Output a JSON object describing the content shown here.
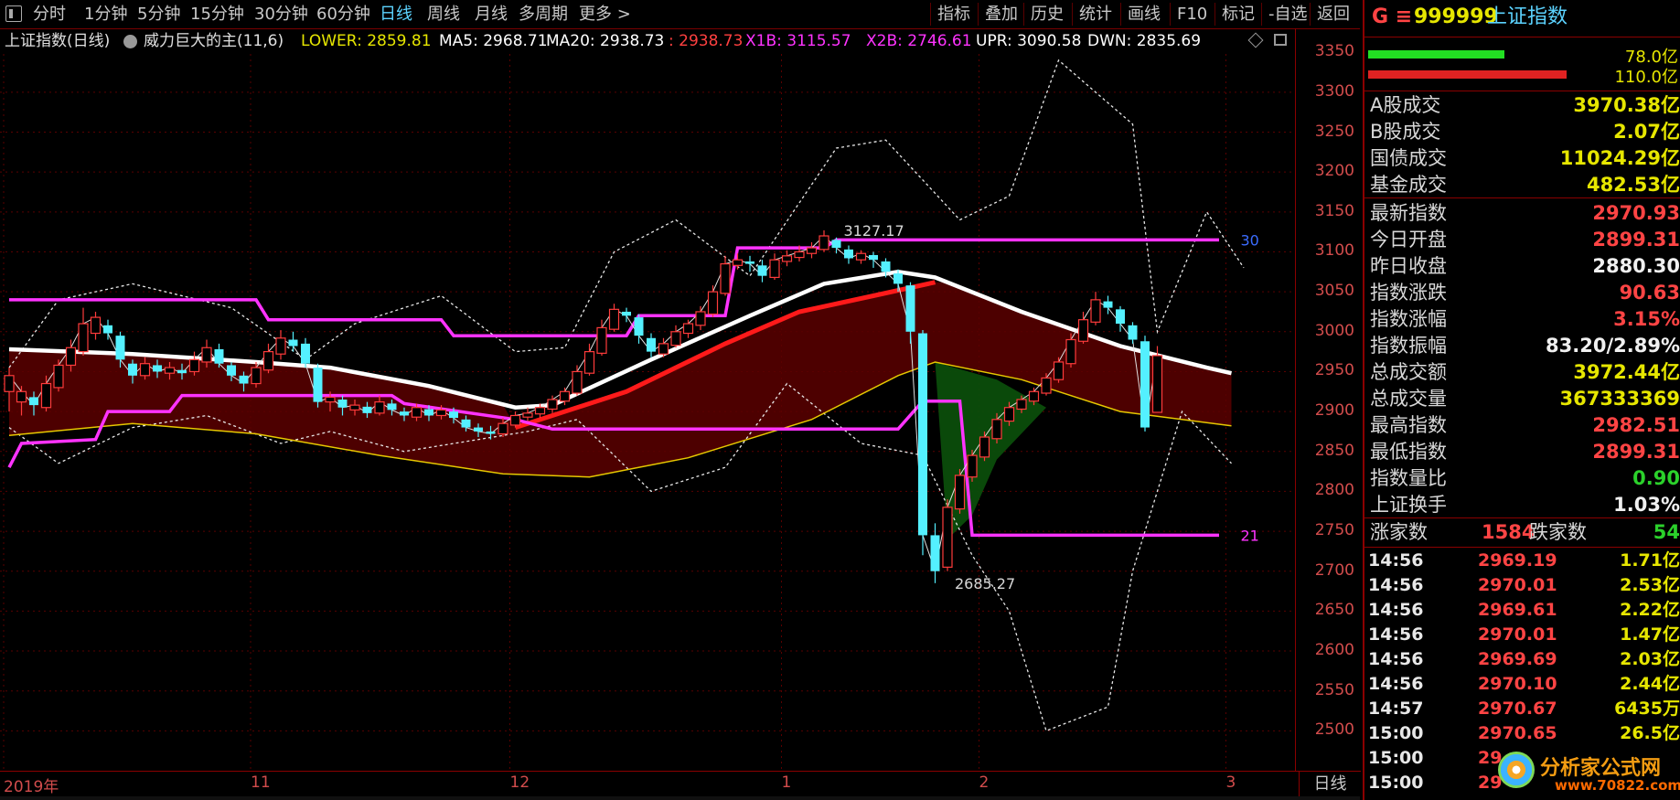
{
  "toolbar": {
    "left_items": [
      "分时",
      "1分钟",
      "5分钟",
      "15分钟",
      "30分钟",
      "60分钟",
      "日线",
      "周线",
      "月线",
      "多周期",
      "更多 >"
    ],
    "active_index": 6,
    "right_items": [
      "指标",
      "叠加",
      "历史",
      "统计",
      "画线",
      "F10",
      "标记",
      "-自选",
      "返回"
    ]
  },
  "info": {
    "title": "上证指数(日线)",
    "indicator": "威力巨大的主(11,6)",
    "lower": "LOWER: 2859.81",
    "ma5": "MA5: 2968.71",
    "ma20": "MA20: 2938.73",
    "blank": ": 2938.73",
    "x1b": "X1B: 3115.57",
    "x2b": "X2B: 2746.61",
    "upr": "UPR: 3090.58",
    "dwn": "DWN: 2835.69"
  },
  "colors": {
    "bg": "#000000",
    "grid": "#5a0000",
    "axis_text": "#d24c4c",
    "up_candle": "#ff3b3b",
    "down_candle": "#54f0ff",
    "magenta": "#ff33ff",
    "white_line": "#ffffff",
    "yellow_line": "#e6c800",
    "fill_dark_red": "#5a0000",
    "fill_green": "#0b4d0b"
  },
  "chart_data": {
    "type": "candlestick",
    "ylim": [
      2450,
      3380
    ],
    "yticks": [
      2500,
      2550,
      2600,
      2650,
      2700,
      2750,
      2800,
      2850,
      2900,
      2950,
      3000,
      3050,
      3100,
      3150,
      3200,
      3250,
      3300,
      3350
    ],
    "date_labels": [
      {
        "text": "2019年",
        "index": 0
      },
      {
        "text": "11",
        "index": 20
      },
      {
        "text": "12",
        "index": 41
      },
      {
        "text": "1",
        "index": 63
      },
      {
        "text": "2",
        "index": 79
      },
      {
        "text": "3",
        "index": 99
      }
    ],
    "candles": [
      [
        2925,
        2945,
        2900,
        2955
      ],
      [
        2912,
        2925,
        2895,
        2932
      ],
      [
        2918,
        2908,
        2895,
        2925
      ],
      [
        2905,
        2935,
        2900,
        2945
      ],
      [
        2930,
        2958,
        2925,
        2965
      ],
      [
        2958,
        2980,
        2950,
        2990
      ],
      [
        2975,
        3010,
        2970,
        3030
      ],
      [
        2998,
        3018,
        2990,
        3025
      ],
      [
        3008,
        2998,
        2990,
        3015
      ],
      [
        2995,
        2965,
        2955,
        3000
      ],
      [
        2960,
        2945,
        2935,
        2965
      ],
      [
        2945,
        2960,
        2940,
        2968
      ],
      [
        2958,
        2950,
        2942,
        2965
      ],
      [
        2948,
        2955,
        2940,
        2962
      ],
      [
        2952,
        2948,
        2940,
        2960
      ],
      [
        2950,
        2965,
        2945,
        2975
      ],
      [
        2962,
        2980,
        2955,
        2990
      ],
      [
        2978,
        2960,
        2955,
        2985
      ],
      [
        2958,
        2945,
        2938,
        2962
      ],
      [
        2945,
        2935,
        2925,
        2950
      ],
      [
        2935,
        2955,
        2930,
        2962
      ],
      [
        2952,
        2975,
        2948,
        2985
      ],
      [
        2972,
        2992,
        2965,
        3002
      ],
      [
        2990,
        2982,
        2975,
        3000
      ],
      [
        2985,
        2960,
        2955,
        2992
      ],
      [
        2955,
        2912,
        2905,
        2960
      ],
      [
        2912,
        2918,
        2900,
        2925
      ],
      [
        2915,
        2905,
        2895,
        2920
      ],
      [
        2902,
        2908,
        2895,
        2915
      ],
      [
        2906,
        2898,
        2892,
        2912
      ],
      [
        2898,
        2912,
        2895,
        2920
      ],
      [
        2910,
        2902,
        2895,
        2915
      ],
      [
        2900,
        2895,
        2888,
        2905
      ],
      [
        2893,
        2905,
        2888,
        2910
      ],
      [
        2903,
        2895,
        2888,
        2908
      ],
      [
        2895,
        2902,
        2890,
        2908
      ],
      [
        2900,
        2892,
        2885,
        2905
      ],
      [
        2890,
        2880,
        2875,
        2895
      ],
      [
        2880,
        2875,
        2868,
        2885
      ],
      [
        2875,
        2872,
        2865,
        2882
      ],
      [
        2872,
        2885,
        2868,
        2892
      ],
      [
        2883,
        2895,
        2880,
        2900
      ],
      [
        2893,
        2898,
        2888,
        2905
      ],
      [
        2897,
        2905,
        2892,
        2910
      ],
      [
        2903,
        2915,
        2898,
        2920
      ],
      [
        2913,
        2925,
        2908,
        2930
      ],
      [
        2923,
        2950,
        2920,
        2958
      ],
      [
        2948,
        2975,
        2945,
        2985
      ],
      [
        2973,
        3005,
        2970,
        3015
      ],
      [
        3003,
        3028,
        3000,
        3035
      ],
      [
        3025,
        3020,
        3012,
        3030
      ],
      [
        3018,
        2995,
        2985,
        3022
      ],
      [
        2992,
        2975,
        2968,
        2998
      ],
      [
        2972,
        2985,
        2968,
        2992
      ],
      [
        2983,
        3000,
        2980,
        3008
      ],
      [
        2998,
        3010,
        2992,
        3015
      ],
      [
        3008,
        3025,
        3002,
        3032
      ],
      [
        3022,
        3050,
        3018,
        3058
      ],
      [
        3048,
        3085,
        3045,
        3095
      ],
      [
        3083,
        3090,
        3078,
        3098
      ],
      [
        3088,
        3085,
        3075,
        3095
      ],
      [
        3083,
        3070,
        3062,
        3090
      ],
      [
        3068,
        3090,
        3065,
        3098
      ],
      [
        3088,
        3095,
        3082,
        3102
      ],
      [
        3093,
        3100,
        3088,
        3108
      ],
      [
        3098,
        3105,
        3092,
        3112
      ],
      [
        3103,
        3120,
        3100,
        3127
      ],
      [
        3115,
        3105,
        3098,
        3118
      ],
      [
        3103,
        3092,
        3085,
        3108
      ],
      [
        3090,
        3098,
        3085,
        3102
      ],
      [
        3096,
        3090,
        3080,
        3100
      ],
      [
        3088,
        3075,
        3068,
        3092
      ],
      [
        3073,
        3060,
        3050,
        3078
      ],
      [
        3058,
        3000,
        2985,
        3062
      ],
      [
        2998,
        2745,
        2720,
        3002
      ],
      [
        2745,
        2700,
        2685,
        2760
      ],
      [
        2705,
        2780,
        2700,
        2790
      ],
      [
        2778,
        2820,
        2772,
        2828
      ],
      [
        2818,
        2845,
        2812,
        2852
      ],
      [
        2843,
        2868,
        2838,
        2875
      ],
      [
        2866,
        2890,
        2860,
        2898
      ],
      [
        2888,
        2905,
        2882,
        2912
      ],
      [
        2903,
        2915,
        2898,
        2920
      ],
      [
        2913,
        2925,
        2908,
        2930
      ],
      [
        2923,
        2942,
        2920,
        2948
      ],
      [
        2940,
        2962,
        2936,
        2968
      ],
      [
        2960,
        2990,
        2955,
        2998
      ],
      [
        2988,
        3015,
        2985,
        3025
      ],
      [
        3012,
        3040,
        3008,
        3050
      ],
      [
        3038,
        3030,
        3022,
        3045
      ],
      [
        3028,
        3010,
        3000,
        3032
      ],
      [
        3008,
        2990,
        2985,
        3012
      ],
      [
        2988,
        2880,
        2875,
        2995
      ],
      [
        2899,
        2970,
        2899,
        2982
      ]
    ],
    "lines": {
      "upper_dotted": [
        [
          0,
          2955
        ],
        [
          4,
          3040
        ],
        [
          10,
          3060
        ],
        [
          18,
          3030
        ],
        [
          24,
          2965
        ],
        [
          28,
          3010
        ],
        [
          35,
          3045
        ],
        [
          41,
          2975
        ],
        [
          45,
          2980
        ],
        [
          49,
          3100
        ],
        [
          54,
          3140
        ],
        [
          60,
          3070
        ],
        [
          67,
          3230
        ],
        [
          71,
          3240
        ],
        [
          77,
          3140
        ],
        [
          81,
          3170
        ],
        [
          85,
          3340
        ],
        [
          91,
          3260
        ],
        [
          93,
          3000
        ],
        [
          97,
          3150
        ],
        [
          100,
          3080
        ]
      ],
      "lower_dotted": [
        [
          0,
          2880
        ],
        [
          4,
          2835
        ],
        [
          10,
          2880
        ],
        [
          16,
          2895
        ],
        [
          22,
          2860
        ],
        [
          26,
          2875
        ],
        [
          32,
          2850
        ],
        [
          38,
          2865
        ],
        [
          42,
          2875
        ],
        [
          46,
          2890
        ],
        [
          52,
          2800
        ],
        [
          58,
          2830
        ],
        [
          63,
          2935
        ],
        [
          69,
          2860
        ],
        [
          74,
          2845
        ],
        [
          78,
          2720
        ],
        [
          81,
          2650
        ],
        [
          84,
          2500
        ],
        [
          89,
          2530
        ],
        [
          91,
          2700
        ],
        [
          95,
          2900
        ],
        [
          99,
          2835
        ]
      ],
      "white_thick": [
        [
          0,
          2978
        ],
        [
          10,
          2972
        ],
        [
          20,
          2962
        ],
        [
          26,
          2955
        ],
        [
          34,
          2932
        ],
        [
          41,
          2905
        ],
        [
          44,
          2908
        ],
        [
          52,
          2965
        ],
        [
          60,
          3020
        ],
        [
          66,
          3060
        ],
        [
          72,
          3075
        ],
        [
          75,
          3068
        ],
        [
          82,
          3025
        ],
        [
          90,
          2982
        ],
        [
          97,
          2955
        ],
        [
          99,
          2948
        ]
      ],
      "red_thick": [
        [
          41,
          2880
        ],
        [
          50,
          2925
        ],
        [
          58,
          2985
        ],
        [
          64,
          3025
        ],
        [
          70,
          3045
        ],
        [
          75,
          3062
        ]
      ],
      "yellow": [
        [
          0,
          2870
        ],
        [
          10,
          2885
        ],
        [
          20,
          2872
        ],
        [
          30,
          2845
        ],
        [
          40,
          2822
        ],
        [
          47,
          2818
        ],
        [
          55,
          2842
        ],
        [
          65,
          2890
        ],
        [
          72,
          2945
        ],
        [
          75,
          2962
        ],
        [
          82,
          2940
        ],
        [
          90,
          2900
        ],
        [
          99,
          2882
        ]
      ],
      "magenta_step": [
        [
          0,
          2830
        ],
        [
          1,
          2860
        ],
        [
          7,
          2865
        ],
        [
          8,
          2900
        ],
        [
          13,
          2900
        ],
        [
          14,
          2920
        ],
        [
          31,
          2920
        ],
        [
          32,
          2910
        ],
        [
          41,
          2890
        ],
        [
          44,
          2878
        ],
        [
          72,
          2878
        ],
        [
          74,
          2913
        ],
        [
          77,
          2913
        ],
        [
          78,
          2745
        ],
        [
          98,
          2745
        ]
      ],
      "magenta_upper": [
        [
          0,
          3040
        ],
        [
          20,
          3040
        ],
        [
          21,
          3015
        ],
        [
          35,
          3015
        ],
        [
          36,
          2995
        ],
        [
          50,
          2995
        ],
        [
          51,
          3020
        ],
        [
          58,
          3020
        ],
        [
          59,
          3105
        ],
        [
          66,
          3105
        ],
        [
          67,
          3115
        ],
        [
          98,
          3115
        ]
      ]
    },
    "annotations": [
      {
        "text": "3127.17",
        "index": 67,
        "value": 3127
      },
      {
        "text": "2685.27",
        "index": 76,
        "value": 2685
      },
      {
        "text": "30",
        "index": 99,
        "value": 3115
      },
      {
        "text": "21",
        "index": 99,
        "value": 2745
      }
    ]
  },
  "period_label": "日线",
  "panel": {
    "code_prefix": "G ≡",
    "code": "999999",
    "name": "上证指数",
    "bars": [
      {
        "value": "78.0亿",
        "fill": 0.44,
        "color": "#22e022"
      },
      {
        "value": "110.0亿",
        "fill": 0.64,
        "color": "#e02222"
      }
    ],
    "trade_rows": [
      {
        "label": "A股成交",
        "value": "3970.38亿",
        "color": "yellow"
      },
      {
        "label": "B股成交",
        "value": "2.07亿",
        "color": "yellow"
      },
      {
        "label": "国债成交",
        "value": "11024.29亿",
        "color": "yellow"
      },
      {
        "label": "基金成交",
        "value": "482.53亿",
        "color": "yellow"
      }
    ],
    "stat_rows": [
      {
        "label": "最新指数",
        "value": "2970.93",
        "color": "red"
      },
      {
        "label": "今日开盘",
        "value": "2899.31",
        "color": "red"
      },
      {
        "label": "昨日收盘",
        "value": "2880.30",
        "color": "white"
      },
      {
        "label": "指数涨跌",
        "value": "90.63",
        "color": "red"
      },
      {
        "label": "指数涨幅",
        "value": "3.15%",
        "color": "red"
      },
      {
        "label": "指数振幅",
        "value": "83.20/2.89%",
        "color": "white"
      },
      {
        "label": "总成交额",
        "value": "3972.44亿",
        "color": "yellow"
      },
      {
        "label": "总成交量",
        "value": "367333369",
        "color": "yellow"
      },
      {
        "label": "最高指数",
        "value": "2982.51",
        "color": "red"
      },
      {
        "label": "最低指数",
        "value": "2899.31",
        "color": "red"
      },
      {
        "label": "指数量比",
        "value": "0.90",
        "color": "green"
      },
      {
        "label": "上证换手",
        "value": "1.03%",
        "color": "white"
      }
    ],
    "updown": {
      "up_label": "涨家数",
      "up_value": "1584",
      "down_label": "跌家数",
      "down_value": "54"
    },
    "ticks": [
      {
        "time": "14:56",
        "price": "2969.19",
        "vol": "1.71亿"
      },
      {
        "time": "14:56",
        "price": "2970.01",
        "vol": "2.53亿"
      },
      {
        "time": "14:56",
        "price": "2969.61",
        "vol": "2.22亿"
      },
      {
        "time": "14:56",
        "price": "2970.01",
        "vol": "1.47亿"
      },
      {
        "time": "14:56",
        "price": "2969.69",
        "vol": "2.03亿"
      },
      {
        "time": "14:56",
        "price": "2970.10",
        "vol": "2.44亿"
      },
      {
        "time": "14:57",
        "price": "2970.67",
        "vol": "6435万"
      },
      {
        "time": "15:00",
        "price": "2970.65",
        "vol": "26.5亿"
      },
      {
        "time": "15:00",
        "price": "29",
        "vol": ""
      },
      {
        "time": "15:00",
        "price": "29",
        "vol": ""
      }
    ],
    "watermark_text": "分析家公式网",
    "watermark_url": "www.70822.com"
  }
}
